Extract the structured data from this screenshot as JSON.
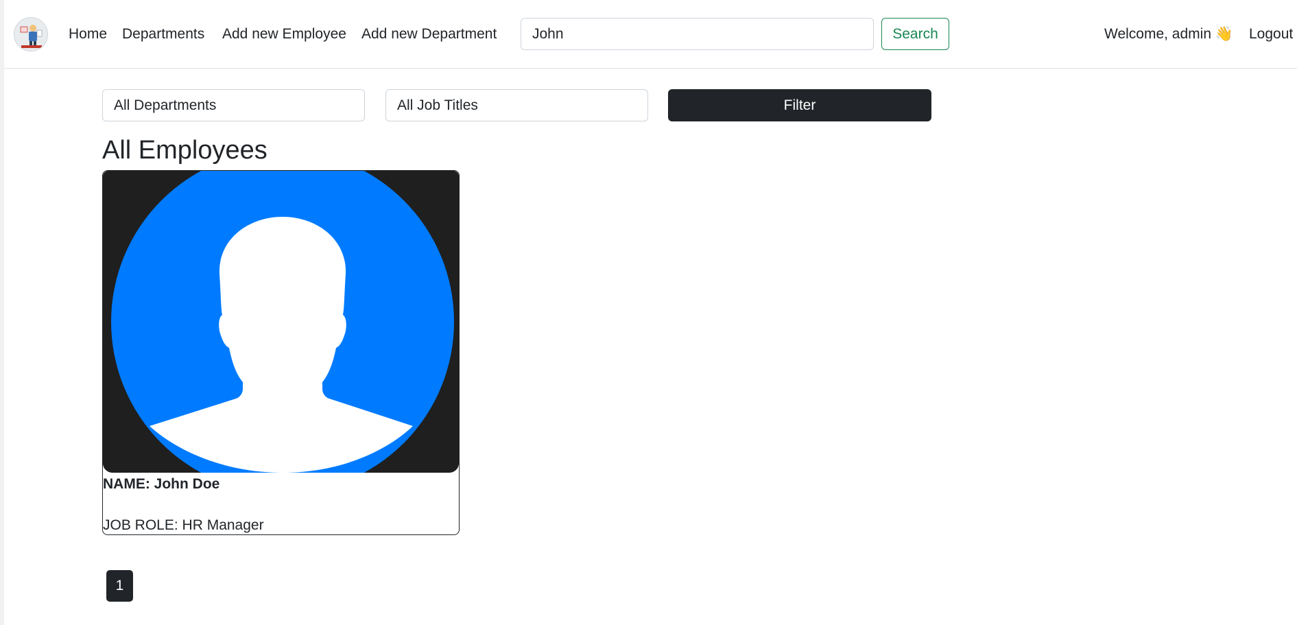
{
  "navbar": {
    "links": [
      {
        "label": "Home"
      },
      {
        "label": "Departments"
      },
      {
        "label": "Add new Employee"
      },
      {
        "label": "Add new Department"
      }
    ],
    "search": {
      "value": "John",
      "button_label": "Search"
    },
    "welcome": "Welcome, admin 👋",
    "logout_label": "Logout"
  },
  "filters": {
    "department_selected": "All Departments",
    "job_title_selected": "All Job Titles",
    "filter_label": "Filter"
  },
  "main": {
    "title": "All Employees",
    "employees": [
      {
        "name": "NAME: John Doe",
        "role": "JOB ROLE: HR Manager",
        "avatar_icon": "user-silhouette-icon"
      }
    ]
  },
  "pagination": {
    "pages": [
      "1"
    ]
  },
  "colors": {
    "primary_dark": "#212529",
    "success_green": "#198754",
    "avatar_blue": "#007bff",
    "avatar_bg": "#1f1f1f"
  }
}
